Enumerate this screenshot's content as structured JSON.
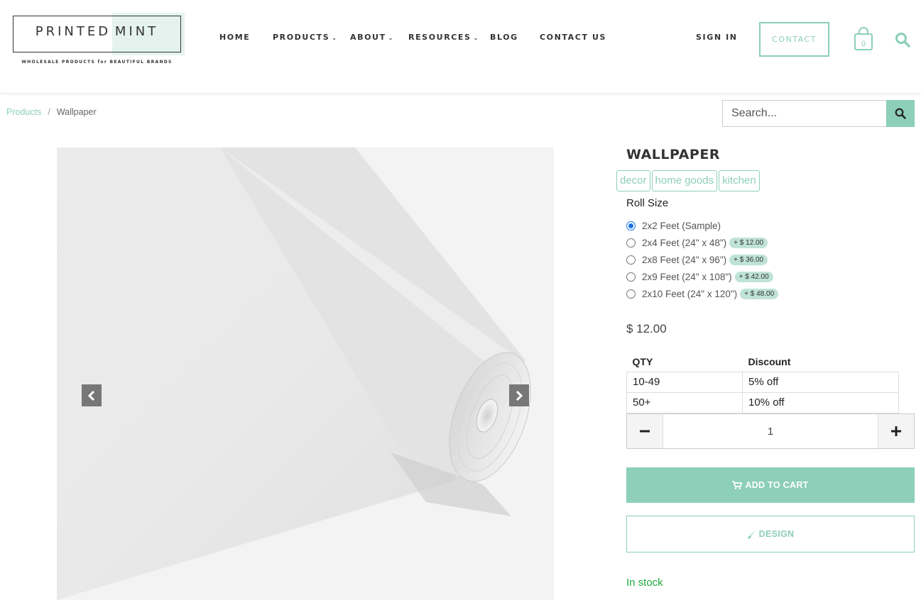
{
  "brand": {
    "name_left": "PRINTED",
    "name_right": "MINT",
    "tagline": "WHOLESALE PRODUCTS for BEAUTIFUL BRANDS"
  },
  "nav": {
    "home": "HOME",
    "products": "PRODUCTS",
    "about": "ABOUT",
    "resources": "RESOURCES",
    "blog": "BLOG",
    "contact_us": "CONTACT US",
    "sign_in": "SIGN IN",
    "contact": "CONTACT",
    "cart_count": "0"
  },
  "breadcrumb": {
    "parent": "Products",
    "separator": "/",
    "current": "Wallpaper"
  },
  "search": {
    "placeholder": "Search..."
  },
  "product": {
    "title": "WALLPAPER",
    "tags": [
      "decor",
      "home goods",
      "kitchen"
    ],
    "option_label": "Roll Size",
    "options": [
      {
        "label": "2x2 Feet (Sample)",
        "extra": "",
        "selected": true
      },
      {
        "label": "2x4 Feet (24\" x 48\")",
        "extra": "+ $ 12.00",
        "selected": false
      },
      {
        "label": "2x8 Feet (24\" x 96\")",
        "extra": "+ $ 36.00",
        "selected": false
      },
      {
        "label": "2x9 Feet (24\" x 108\")",
        "extra": "+ $ 42.00",
        "selected": false
      },
      {
        "label": "2x10 Feet (24\" x 120\")",
        "extra": "+ $ 48.00",
        "selected": false
      }
    ],
    "price": "$ 12.00",
    "discount_table": {
      "headers": [
        "QTY",
        "Discount"
      ],
      "rows": [
        [
          "10-49",
          "5% off"
        ],
        [
          "50+",
          "10% off"
        ]
      ]
    },
    "quantity": "1",
    "add_to_cart": "ADD TO CART",
    "design": "DESIGN",
    "stock": "In stock"
  },
  "colors": {
    "accent": "#8dcfb9",
    "accent_light": "#e4f3ee",
    "stock_green": "#1fab3a"
  },
  "icons": {
    "cart": "shopping-bag-icon",
    "search": "search-icon",
    "prev": "chevron-left-icon",
    "next": "chevron-right-icon",
    "add_cart": "cart-icon",
    "design": "brush-icon"
  }
}
